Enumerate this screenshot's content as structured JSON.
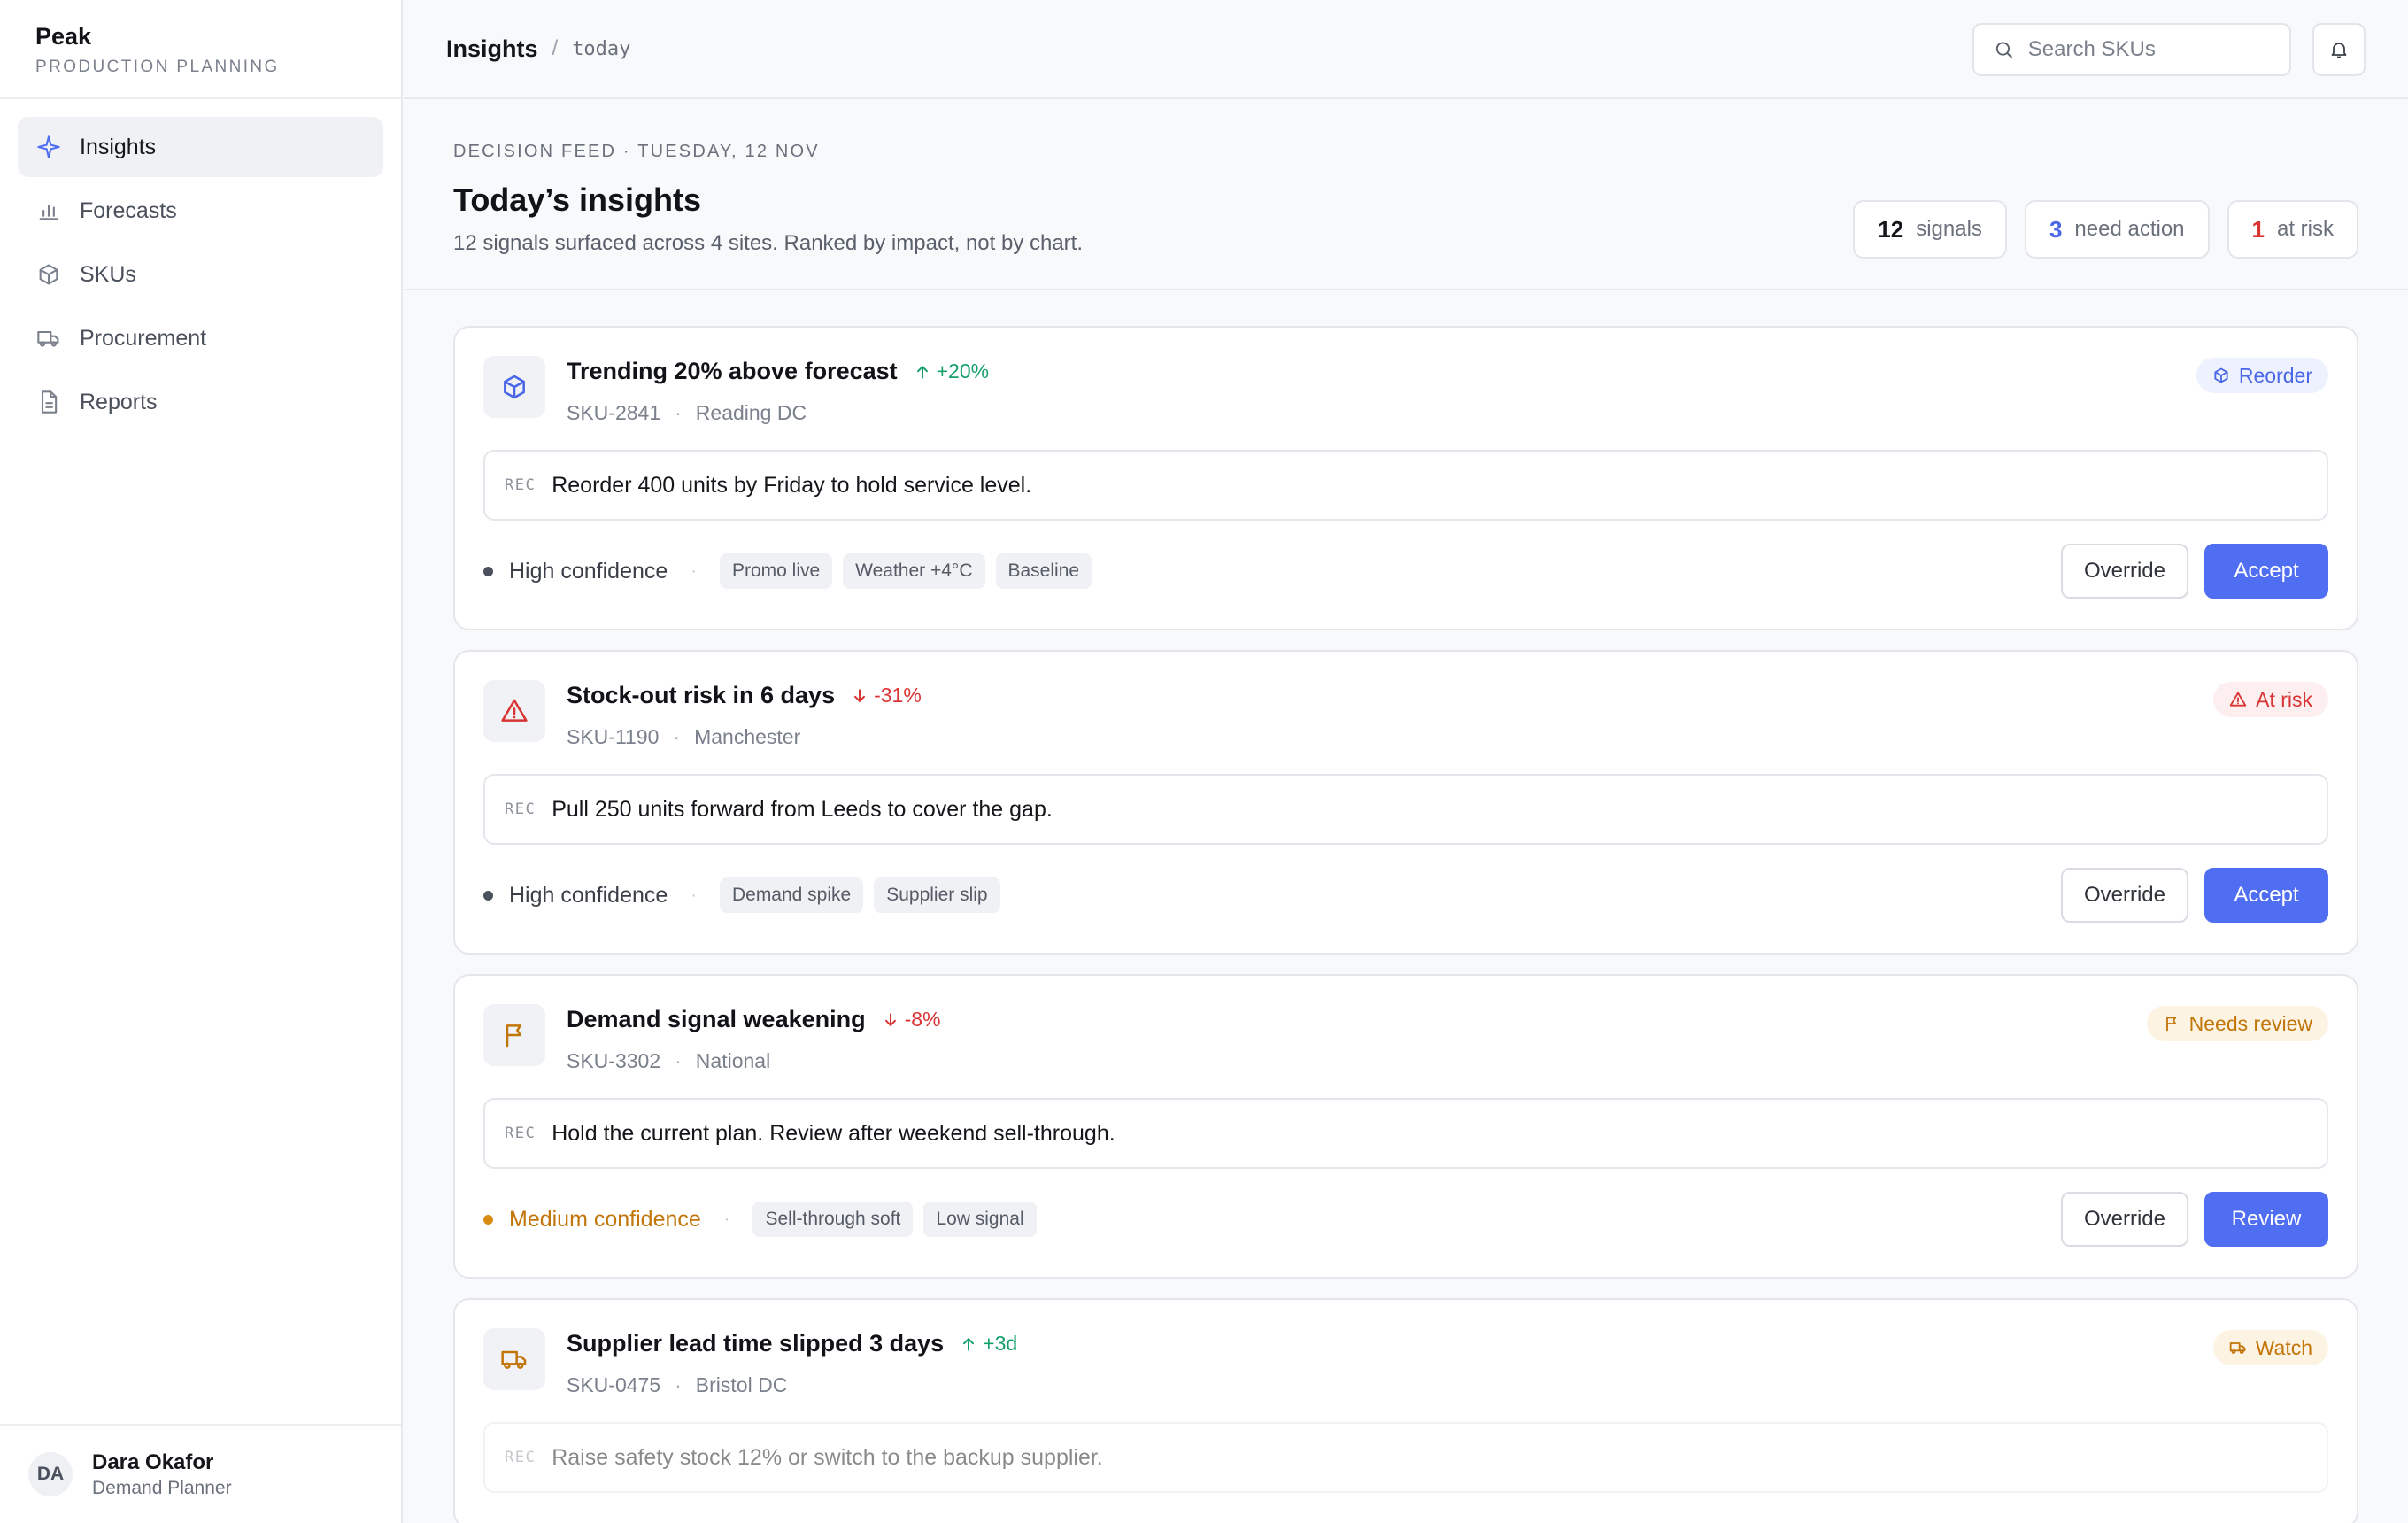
{
  "app": {
    "name": "Peak",
    "subtitle": "PRODUCTION PLANNING"
  },
  "sidebar": {
    "items": [
      {
        "label": "Insights",
        "icon": "sparkle-icon",
        "active": true
      },
      {
        "label": "Forecasts",
        "icon": "bar-chart-icon"
      },
      {
        "label": "SKUs",
        "icon": "box-icon"
      },
      {
        "label": "Procurement",
        "icon": "truck-icon"
      },
      {
        "label": "Reports",
        "icon": "document-icon"
      }
    ]
  },
  "user": {
    "initials": "DA",
    "name": "Dara Okafor",
    "role": "Demand Planner"
  },
  "topbar": {
    "title": "Insights",
    "separator": "/",
    "sub": "today",
    "search_placeholder": "Search SKUs"
  },
  "header": {
    "eyebrow": "DECISION FEED · TUESDAY, 12 NOV",
    "title": "Today’s insights",
    "description": "12 signals surfaced across 4 sites. Ranked by impact, not by chart.",
    "stats": [
      {
        "value": "12",
        "label": "signals",
        "color": "#14161a"
      },
      {
        "value": "3",
        "label": "need action",
        "color": "#4a67e8"
      },
      {
        "value": "1",
        "label": "at risk",
        "color": "#d93434"
      }
    ]
  },
  "cards": [
    {
      "title": "Trending 20% above forecast",
      "delta": "+20%",
      "delta_dir": "up",
      "sku": "SKU-2841",
      "site": "Reading DC",
      "badge": "Reorder",
      "badge_icon": "box-icon",
      "rec_tag": "REC",
      "rec": "Reorder 400 units by Friday to hold service level.",
      "confidence": "High confidence",
      "tags": [
        "Promo live",
        "Weather +4°C",
        "Baseline"
      ],
      "secondary": "Override",
      "primary": "Accept"
    },
    {
      "title": "Stock-out risk in 6 days",
      "delta": "-31%",
      "delta_dir": "down",
      "sku": "SKU-1190",
      "site": "Manchester",
      "badge": "At risk",
      "badge_icon": "warning-icon",
      "rec_tag": "REC",
      "rec": "Pull 250 units forward from Leeds to cover the gap.",
      "confidence": "High confidence",
      "tags": [
        "Demand spike",
        "Supplier slip"
      ],
      "secondary": "Override",
      "primary": "Accept"
    },
    {
      "title": "Demand signal weakening",
      "delta": "-8%",
      "delta_dir": "down",
      "sku": "SKU-3302",
      "site": "National",
      "badge": "Needs review",
      "badge_icon": "flag-icon",
      "rec_tag": "REC",
      "rec": "Hold the current plan. Review after weekend sell-through.",
      "confidence": "Medium confidence",
      "tags": [
        "Sell-through soft",
        "Low signal"
      ],
      "secondary": "Override",
      "primary": "Review"
    },
    {
      "title": "Supplier lead time slipped 3 days",
      "delta": "+3d",
      "delta_dir": "up",
      "sku": "SKU-0475",
      "site": "Bristol DC",
      "badge": "Watch",
      "badge_icon": "truck-icon",
      "rec_tag": "REC",
      "rec": "Raise safety stock 12% or switch to the backup supplier."
    }
  ],
  "meta_separator": "·",
  "colors": {
    "accent": "#4f6ef2",
    "up": "#16a06a",
    "down": "#d93434",
    "amber": "#c27508"
  }
}
